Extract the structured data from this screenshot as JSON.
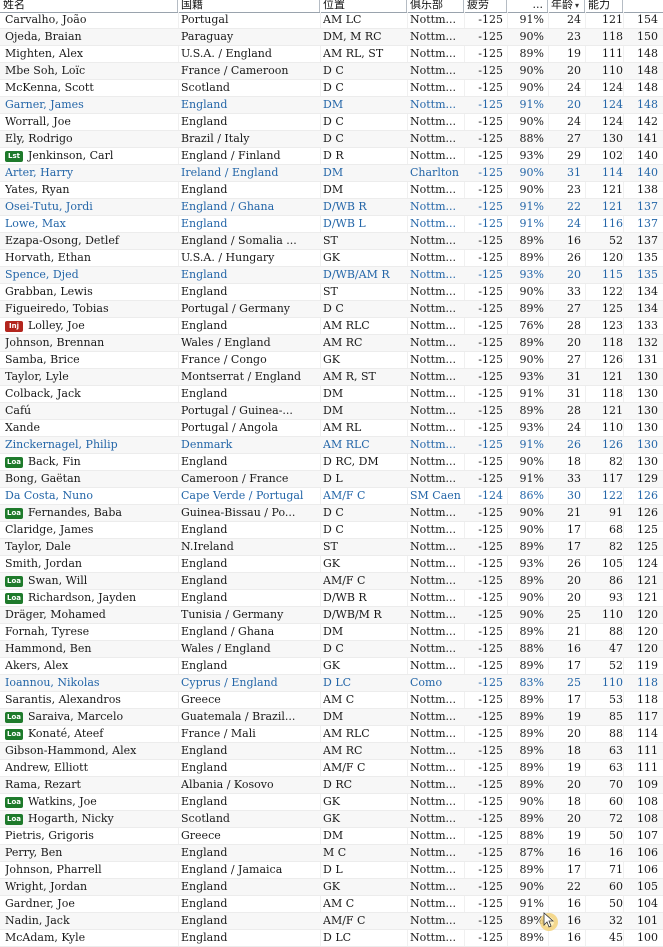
{
  "columns": {
    "name": "姓名",
    "nationality": "国籍",
    "position": "位置",
    "club": "俱乐部",
    "cost": "疲劳",
    "fitness": "...",
    "age": "年龄",
    "ca": "能力",
    "pa": ""
  },
  "colors": {
    "highlight": "#2466a8",
    "loan_badge": "#1e7a2b",
    "injury_badge": "#b3261e"
  },
  "rows": [
    {
      "name": "Carvalho, João",
      "nat": "Portugal",
      "pos": "AM LC",
      "club": "Nottm...",
      "cost": "-125",
      "fit": "91%",
      "age": "24",
      "ca": "121",
      "pa": "154",
      "badge": "",
      "hl": false
    },
    {
      "name": "Ojeda, Braian",
      "nat": "Paraguay",
      "pos": "DM, M RC",
      "club": "Nottm...",
      "cost": "-125",
      "fit": "90%",
      "age": "23",
      "ca": "118",
      "pa": "150",
      "badge": "",
      "hl": false
    },
    {
      "name": "Mighten, Alex",
      "nat": "U.S.A. / England",
      "pos": "AM RL, ST",
      "club": "Nottm...",
      "cost": "-125",
      "fit": "89%",
      "age": "19",
      "ca": "111",
      "pa": "148",
      "badge": "",
      "hl": false
    },
    {
      "name": "Mbe Soh, Loïc",
      "nat": "France / Cameroon",
      "pos": "D C",
      "club": "Nottm...",
      "cost": "-125",
      "fit": "90%",
      "age": "20",
      "ca": "110",
      "pa": "148",
      "badge": "",
      "hl": false
    },
    {
      "name": "McKenna, Scott",
      "nat": "Scotland",
      "pos": "D C",
      "club": "Nottm...",
      "cost": "-125",
      "fit": "90%",
      "age": "24",
      "ca": "124",
      "pa": "148",
      "badge": "",
      "hl": false
    },
    {
      "name": "Garner, James",
      "nat": "England",
      "pos": "DM",
      "club": "Nottm...",
      "cost": "-125",
      "fit": "91%",
      "age": "20",
      "ca": "124",
      "pa": "148",
      "badge": "",
      "hl": true
    },
    {
      "name": "Worrall, Joe",
      "nat": "England",
      "pos": "D C",
      "club": "Nottm...",
      "cost": "-125",
      "fit": "90%",
      "age": "24",
      "ca": "124",
      "pa": "142",
      "badge": "",
      "hl": false
    },
    {
      "name": "Ely, Rodrigo",
      "nat": "Brazil / Italy",
      "pos": "D C",
      "club": "Nottm...",
      "cost": "-125",
      "fit": "88%",
      "age": "27",
      "ca": "130",
      "pa": "141",
      "badge": "",
      "hl": false
    },
    {
      "name": "Jenkinson, Carl",
      "nat": "England / Finland",
      "pos": "D R",
      "club": "Nottm...",
      "cost": "-125",
      "fit": "93%",
      "age": "29",
      "ca": "102",
      "pa": "140",
      "badge": "Lst",
      "hl": false
    },
    {
      "name": "Arter, Harry",
      "nat": "Ireland / England",
      "pos": "DM",
      "club": "Charlton",
      "cost": "-125",
      "fit": "90%",
      "age": "31",
      "ca": "114",
      "pa": "140",
      "badge": "",
      "hl": true
    },
    {
      "name": "Yates, Ryan",
      "nat": "England",
      "pos": "DM",
      "club": "Nottm...",
      "cost": "-125",
      "fit": "90%",
      "age": "23",
      "ca": "121",
      "pa": "138",
      "badge": "",
      "hl": false
    },
    {
      "name": "Osei-Tutu, Jordi",
      "nat": "England / Ghana",
      "pos": "D/WB R",
      "club": "Nottm...",
      "cost": "-125",
      "fit": "91%",
      "age": "22",
      "ca": "121",
      "pa": "137",
      "badge": "",
      "hl": true
    },
    {
      "name": "Lowe, Max",
      "nat": "England",
      "pos": "D/WB L",
      "club": "Nottm...",
      "cost": "-125",
      "fit": "91%",
      "age": "24",
      "ca": "116",
      "pa": "137",
      "badge": "",
      "hl": true
    },
    {
      "name": "Ezapa-Osong, Detlef",
      "nat": "England / Somalia ...",
      "pos": "ST",
      "club": "Nottm...",
      "cost": "-125",
      "fit": "89%",
      "age": "16",
      "ca": "52",
      "pa": "137",
      "badge": "",
      "hl": false
    },
    {
      "name": "Horvath, Ethan",
      "nat": "U.S.A. / Hungary",
      "pos": "GK",
      "club": "Nottm...",
      "cost": "-125",
      "fit": "89%",
      "age": "26",
      "ca": "120",
      "pa": "135",
      "badge": "",
      "hl": false
    },
    {
      "name": "Spence, Djed",
      "nat": "England",
      "pos": "D/WB/AM R",
      "club": "Nottm...",
      "cost": "-125",
      "fit": "93%",
      "age": "20",
      "ca": "115",
      "pa": "135",
      "badge": "",
      "hl": true
    },
    {
      "name": "Grabban, Lewis",
      "nat": "England",
      "pos": "ST",
      "club": "Nottm...",
      "cost": "-125",
      "fit": "90%",
      "age": "33",
      "ca": "122",
      "pa": "134",
      "badge": "",
      "hl": false
    },
    {
      "name": "Figueiredo, Tobias",
      "nat": "Portugal / Germany",
      "pos": "D C",
      "club": "Nottm...",
      "cost": "-125",
      "fit": "89%",
      "age": "27",
      "ca": "125",
      "pa": "134",
      "badge": "",
      "hl": false
    },
    {
      "name": "Lolley, Joe",
      "nat": "England",
      "pos": "AM RLC",
      "club": "Nottm...",
      "cost": "-125",
      "fit": "76%",
      "age": "28",
      "ca": "123",
      "pa": "133",
      "badge": "Inj",
      "hl": false
    },
    {
      "name": "Johnson, Brennan",
      "nat": "Wales / England",
      "pos": "AM RC",
      "club": "Nottm...",
      "cost": "-125",
      "fit": "89%",
      "age": "20",
      "ca": "118",
      "pa": "132",
      "badge": "",
      "hl": false
    },
    {
      "name": "Samba, Brice",
      "nat": "France / Congo",
      "pos": "GK",
      "club": "Nottm...",
      "cost": "-125",
      "fit": "90%",
      "age": "27",
      "ca": "126",
      "pa": "131",
      "badge": "",
      "hl": false
    },
    {
      "name": "Taylor, Lyle",
      "nat": "Montserrat / England",
      "pos": "AM R, ST",
      "club": "Nottm...",
      "cost": "-125",
      "fit": "93%",
      "age": "31",
      "ca": "121",
      "pa": "130",
      "badge": "",
      "hl": false
    },
    {
      "name": "Colback, Jack",
      "nat": "England",
      "pos": "DM",
      "club": "Nottm...",
      "cost": "-125",
      "fit": "91%",
      "age": "31",
      "ca": "118",
      "pa": "130",
      "badge": "",
      "hl": false
    },
    {
      "name": "Cafú",
      "nat": "Portugal / Guinea-...",
      "pos": "DM",
      "club": "Nottm...",
      "cost": "-125",
      "fit": "89%",
      "age": "28",
      "ca": "121",
      "pa": "130",
      "badge": "",
      "hl": false
    },
    {
      "name": "Xande",
      "nat": "Portugal / Angola",
      "pos": "AM RL",
      "club": "Nottm...",
      "cost": "-125",
      "fit": "93%",
      "age": "24",
      "ca": "110",
      "pa": "130",
      "badge": "",
      "hl": false
    },
    {
      "name": "Zinckernagel, Philip",
      "nat": "Denmark",
      "pos": "AM RLC",
      "club": "Nottm...",
      "cost": "-125",
      "fit": "91%",
      "age": "26",
      "ca": "126",
      "pa": "130",
      "badge": "",
      "hl": true
    },
    {
      "name": "Back, Fin",
      "nat": "England",
      "pos": "D RC, DM",
      "club": "Nottm...",
      "cost": "-125",
      "fit": "90%",
      "age": "18",
      "ca": "82",
      "pa": "130",
      "badge": "Loa",
      "hl": false
    },
    {
      "name": "Bong, Gaëtan",
      "nat": "Cameroon / France",
      "pos": "D L",
      "club": "Nottm...",
      "cost": "-125",
      "fit": "91%",
      "age": "33",
      "ca": "117",
      "pa": "129",
      "badge": "",
      "hl": false
    },
    {
      "name": "Da Costa, Nuno",
      "nat": "Cape Verde / Portugal",
      "pos": "AM/F C",
      "club": "SM Caen",
      "cost": "-124",
      "fit": "86%",
      "age": "30",
      "ca": "122",
      "pa": "126",
      "badge": "",
      "hl": true
    },
    {
      "name": "Fernandes, Baba",
      "nat": "Guinea-Bissau / Po...",
      "pos": "D C",
      "club": "Nottm...",
      "cost": "-125",
      "fit": "90%",
      "age": "21",
      "ca": "91",
      "pa": "126",
      "badge": "Loa",
      "hl": false
    },
    {
      "name": "Claridge, James",
      "nat": "England",
      "pos": "D C",
      "club": "Nottm...",
      "cost": "-125",
      "fit": "90%",
      "age": "17",
      "ca": "68",
      "pa": "125",
      "badge": "",
      "hl": false
    },
    {
      "name": "Taylor, Dale",
      "nat": "N.Ireland",
      "pos": "ST",
      "club": "Nottm...",
      "cost": "-125",
      "fit": "89%",
      "age": "17",
      "ca": "82",
      "pa": "125",
      "badge": "",
      "hl": false
    },
    {
      "name": "Smith, Jordan",
      "nat": "England",
      "pos": "GK",
      "club": "Nottm...",
      "cost": "-125",
      "fit": "93%",
      "age": "26",
      "ca": "105",
      "pa": "124",
      "badge": "",
      "hl": false
    },
    {
      "name": "Swan, Will",
      "nat": "England",
      "pos": "AM/F C",
      "club": "Nottm...",
      "cost": "-125",
      "fit": "89%",
      "age": "20",
      "ca": "86",
      "pa": "121",
      "badge": "Loa",
      "hl": false
    },
    {
      "name": "Richardson, Jayden",
      "nat": "England",
      "pos": "D/WB R",
      "club": "Nottm...",
      "cost": "-125",
      "fit": "90%",
      "age": "20",
      "ca": "93",
      "pa": "121",
      "badge": "Loa",
      "hl": false
    },
    {
      "name": "Dräger, Mohamed",
      "nat": "Tunisia / Germany",
      "pos": "D/WB/M R",
      "club": "Nottm...",
      "cost": "-125",
      "fit": "90%",
      "age": "25",
      "ca": "110",
      "pa": "120",
      "badge": "",
      "hl": false
    },
    {
      "name": "Fornah, Tyrese",
      "nat": "England / Ghana",
      "pos": "DM",
      "club": "Nottm...",
      "cost": "-125",
      "fit": "89%",
      "age": "21",
      "ca": "88",
      "pa": "120",
      "badge": "",
      "hl": false
    },
    {
      "name": "Hammond, Ben",
      "nat": "Wales / England",
      "pos": "D C",
      "club": "Nottm...",
      "cost": "-125",
      "fit": "88%",
      "age": "16",
      "ca": "47",
      "pa": "120",
      "badge": "",
      "hl": false
    },
    {
      "name": "Akers, Alex",
      "nat": "England",
      "pos": "GK",
      "club": "Nottm...",
      "cost": "-125",
      "fit": "89%",
      "age": "17",
      "ca": "52",
      "pa": "119",
      "badge": "",
      "hl": false
    },
    {
      "name": "Ioannou, Nikolas",
      "nat": "Cyprus / England",
      "pos": "D LC",
      "club": "Como",
      "cost": "-125",
      "fit": "83%",
      "age": "25",
      "ca": "110",
      "pa": "118",
      "badge": "",
      "hl": true
    },
    {
      "name": "Sarantis, Alexandros",
      "nat": "Greece",
      "pos": "AM C",
      "club": "Nottm...",
      "cost": "-125",
      "fit": "89%",
      "age": "17",
      "ca": "53",
      "pa": "118",
      "badge": "",
      "hl": false
    },
    {
      "name": "Saraiva, Marcelo",
      "nat": "Guatemala / Brazil...",
      "pos": "DM",
      "club": "Nottm...",
      "cost": "-125",
      "fit": "89%",
      "age": "19",
      "ca": "85",
      "pa": "117",
      "badge": "Loa",
      "hl": false
    },
    {
      "name": "Konaté, Ateef",
      "nat": "France / Mali",
      "pos": "AM RLC",
      "club": "Nottm...",
      "cost": "-125",
      "fit": "89%",
      "age": "20",
      "ca": "88",
      "pa": "114",
      "badge": "Loa",
      "hl": false
    },
    {
      "name": "Gibson-Hammond, Alex",
      "nat": "England",
      "pos": "AM RC",
      "club": "Nottm...",
      "cost": "-125",
      "fit": "89%",
      "age": "18",
      "ca": "63",
      "pa": "111",
      "badge": "",
      "hl": false
    },
    {
      "name": "Andrew, Elliott",
      "nat": "England",
      "pos": "AM/F C",
      "club": "Nottm...",
      "cost": "-125",
      "fit": "89%",
      "age": "19",
      "ca": "63",
      "pa": "111",
      "badge": "",
      "hl": false
    },
    {
      "name": "Rama, Rezart",
      "nat": "Albania / Kosovo",
      "pos": "D RC",
      "club": "Nottm...",
      "cost": "-125",
      "fit": "89%",
      "age": "20",
      "ca": "70",
      "pa": "109",
      "badge": "",
      "hl": false
    },
    {
      "name": "Watkins, Joe",
      "nat": "England",
      "pos": "GK",
      "club": "Nottm...",
      "cost": "-125",
      "fit": "90%",
      "age": "18",
      "ca": "60",
      "pa": "108",
      "badge": "Loa",
      "hl": false
    },
    {
      "name": "Hogarth, Nicky",
      "nat": "Scotland",
      "pos": "GK",
      "club": "Nottm...",
      "cost": "-125",
      "fit": "89%",
      "age": "20",
      "ca": "72",
      "pa": "108",
      "badge": "Loa",
      "hl": false
    },
    {
      "name": "Pietris, Grigoris",
      "nat": "Greece",
      "pos": "DM",
      "club": "Nottm...",
      "cost": "-125",
      "fit": "88%",
      "age": "19",
      "ca": "50",
      "pa": "107",
      "badge": "",
      "hl": false
    },
    {
      "name": "Perry, Ben",
      "nat": "England",
      "pos": "M C",
      "club": "Nottm...",
      "cost": "-125",
      "fit": "87%",
      "age": "16",
      "ca": "16",
      "pa": "106",
      "badge": "",
      "hl": false
    },
    {
      "name": "Johnson, Pharrell",
      "nat": "England / Jamaica",
      "pos": "D L",
      "club": "Nottm...",
      "cost": "-125",
      "fit": "89%",
      "age": "17",
      "ca": "71",
      "pa": "106",
      "badge": "",
      "hl": false
    },
    {
      "name": "Wright, Jordan",
      "nat": "England",
      "pos": "GK",
      "club": "Nottm...",
      "cost": "-125",
      "fit": "90%",
      "age": "22",
      "ca": "60",
      "pa": "105",
      "badge": "",
      "hl": false
    },
    {
      "name": "Gardner, Joe",
      "nat": "England",
      "pos": "AM C",
      "club": "Nottm...",
      "cost": "-125",
      "fit": "91%",
      "age": "16",
      "ca": "50",
      "pa": "104",
      "badge": "",
      "hl": false
    },
    {
      "name": "Nadin, Jack",
      "nat": "England",
      "pos": "AM/F C",
      "club": "Nottm...",
      "cost": "-125",
      "fit": "89%",
      "age": "16",
      "ca": "32",
      "pa": "101",
      "badge": "",
      "hl": false
    },
    {
      "name": "McAdam, Kyle",
      "nat": "England",
      "pos": "D LC",
      "club": "Nottm...",
      "cost": "-125",
      "fit": "89%",
      "age": "16",
      "ca": "45",
      "pa": "100",
      "badge": "",
      "hl": false
    }
  ]
}
